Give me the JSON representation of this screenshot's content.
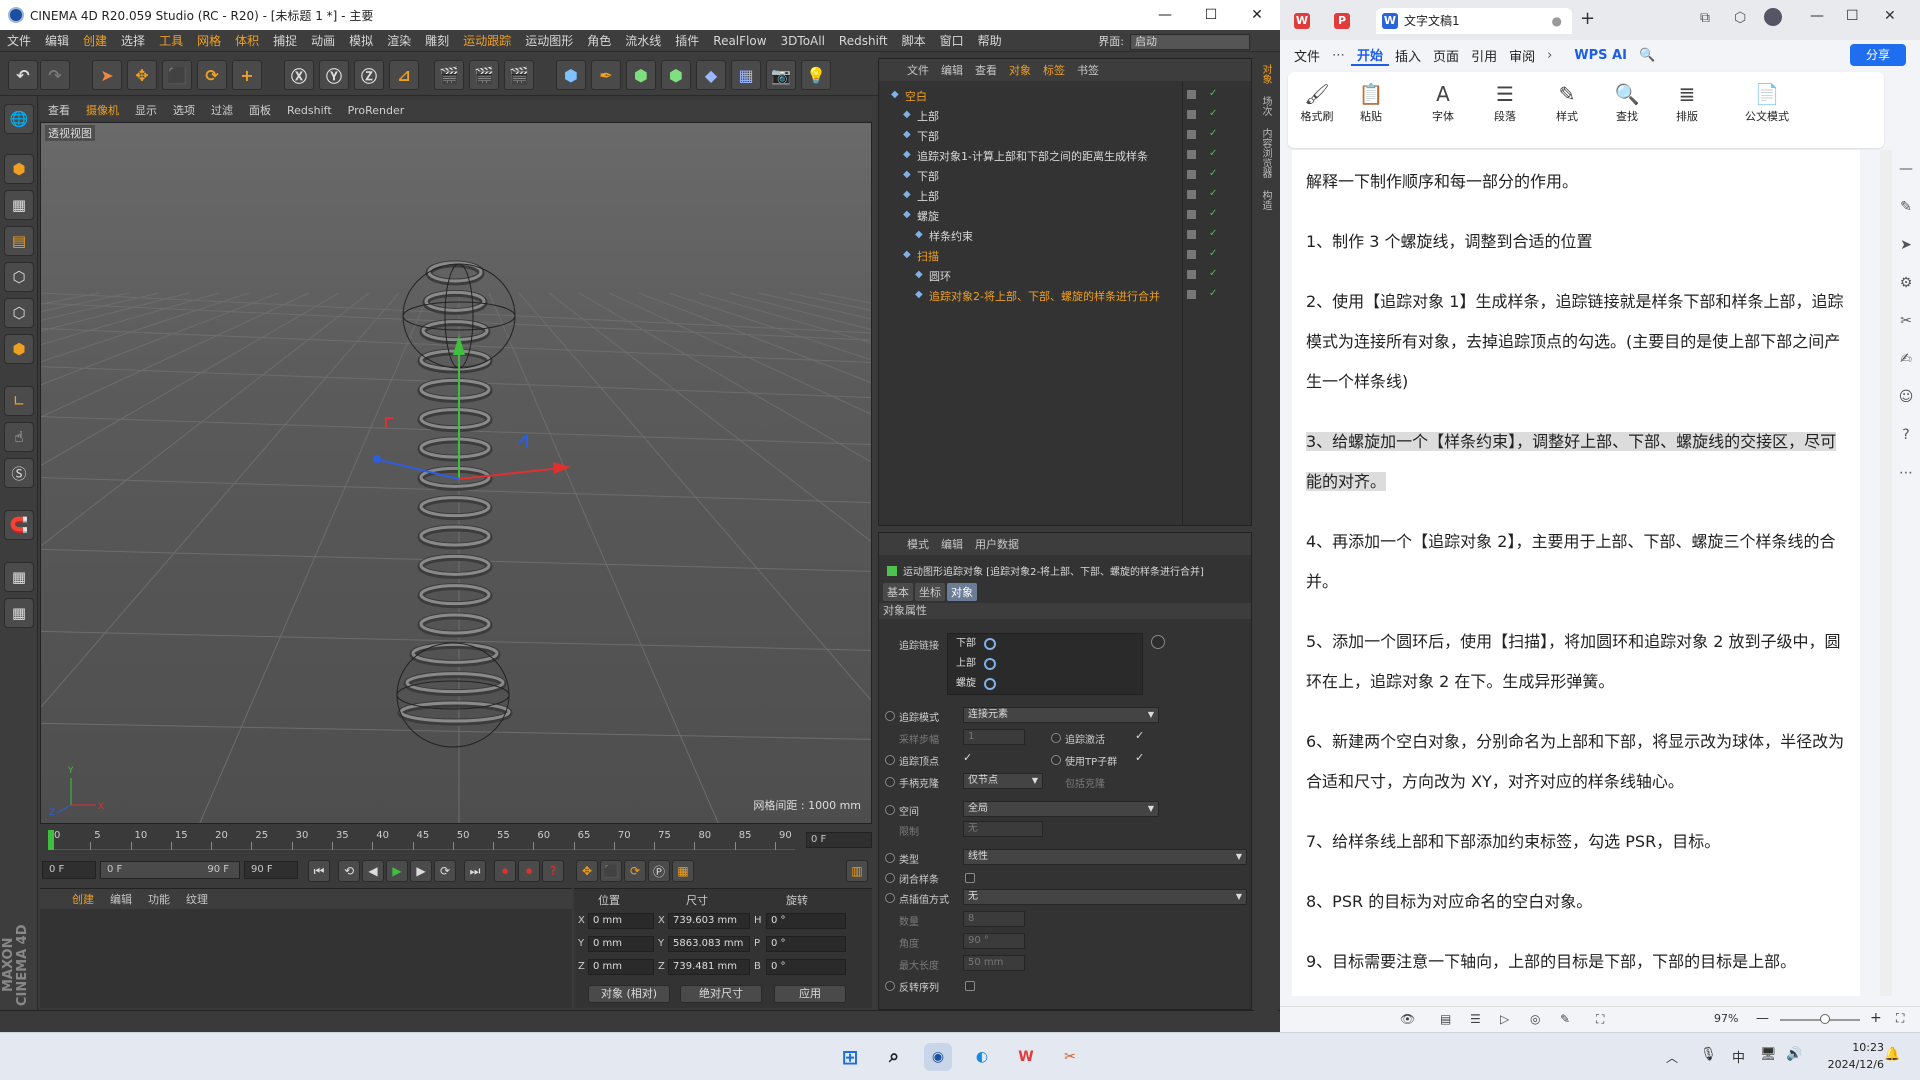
{
  "c4d": {
    "title": "CINEMA 4D R20.059 Studio (RC - R20) - [未标题 1 *] - 主要",
    "menu": [
      "文件",
      "编辑",
      "创建",
      "选择",
      "工具",
      "网格",
      "体积",
      "捕捉",
      "动画",
      "模拟",
      "渲染",
      "雕刻",
      "运动跟踪",
      "运动图形",
      "角色",
      "流水线",
      "插件",
      "RealFlow",
      "3DToAll",
      "Redshift",
      "脚本",
      "窗口",
      "帮助"
    ],
    "interface_label": "界面:",
    "interface_value": "启动",
    "viewport_menu": [
      "查看",
      "摄像机",
      "显示",
      "选项",
      "过滤",
      "面板",
      "Redshift",
      "ProRender"
    ],
    "viewport_label": "透视视图",
    "grid_distance": "网格间距 : 1000 mm",
    "timeline_ticks": [
      "0",
      "5",
      "10",
      "15",
      "20",
      "25",
      "30",
      "35",
      "40",
      "45",
      "50",
      "55",
      "60",
      "65",
      "70",
      "75",
      "80",
      "85",
      "90"
    ],
    "timeline_frame": "0 F",
    "play_start": "0 F",
    "play_range_start": "0 F",
    "play_range_end": "90 F",
    "play_end": "90 F",
    "material_menu": [
      "创建",
      "编辑",
      "功能",
      "纹理"
    ],
    "coords": {
      "headers": [
        "位置",
        "尺寸",
        "旋转"
      ],
      "rows": [
        {
          "axis": "X",
          "pos": "0 mm",
          "size_axis": "X",
          "size": "739.603 mm",
          "rot_axis": "H",
          "rot": "0 °"
        },
        {
          "axis": "Y",
          "pos": "0 mm",
          "size_axis": "Y",
          "size": "5863.083 mm",
          "rot_axis": "P",
          "rot": "0 °"
        },
        {
          "axis": "Z",
          "pos": "0 mm",
          "size_axis": "Z",
          "size": "739.481 mm",
          "rot_axis": "B",
          "rot": "0 °"
        }
      ],
      "mode_select": "对象 (相对)",
      "size_select": "绝对尺寸",
      "apply_label": "应用"
    },
    "maxon_logo": "MAXON CINEMA 4D",
    "object_manager": {
      "menu": [
        "文件",
        "编辑",
        "查看",
        "对象",
        "标签",
        "书签"
      ],
      "items": [
        {
          "name": "空白",
          "indent": 0,
          "selected": true
        },
        {
          "name": "上部",
          "indent": 1,
          "selected": false
        },
        {
          "name": "下部",
          "indent": 1,
          "selected": false
        },
        {
          "name": "追踪对象1-计算上部和下部之间的距离生成样条",
          "indent": 1,
          "selected": false
        },
        {
          "name": "下部",
          "indent": 1,
          "selected": false
        },
        {
          "name": "上部",
          "indent": 1,
          "selected": false
        },
        {
          "name": "螺旋",
          "indent": 1,
          "selected": false
        },
        {
          "name": "样条约束",
          "indent": 2,
          "selected": false
        },
        {
          "name": "扫描",
          "indent": 1,
          "selected": true
        },
        {
          "name": "圆环",
          "indent": 2,
          "selected": false
        },
        {
          "name": "追踪对象2-将上部、下部、螺旋的样条进行合并",
          "indent": 2,
          "selected": true
        }
      ]
    },
    "side_tabs": [
      "对象",
      "场次",
      "内容浏览器",
      "构造"
    ],
    "attribute_manager": {
      "menu": [
        "模式",
        "编辑",
        "用户数据"
      ],
      "title": "运动图形追踪对象 [追踪对象2-将上部、下部、螺旋的样条进行合并]",
      "tabs": [
        "基本",
        "坐标",
        "对象"
      ],
      "section": "对象属性",
      "track_link_label": "追踪链接",
      "track_links": [
        "下部",
        "上部",
        "螺旋"
      ],
      "track_mode_label": "追踪模式",
      "track_mode": "连接元素",
      "sample_step_label": "采样步幅",
      "sample_step": "1",
      "track_active_label": "追踪激活",
      "track_vertex_label": "追踪顶点",
      "use_tp_label": "使用TP子群",
      "handle_clone_label": "手柄克隆",
      "handle_clone": "仅节点",
      "include_clone_label": "包括克隆",
      "space_label": "空间",
      "space": "全局",
      "limit_label": "限制",
      "limit": "无",
      "type_label": "类型",
      "type": "线性",
      "close_spline_label": "闭合样条",
      "interp_label": "点插值方式",
      "interp": "无",
      "count_label": "数量",
      "count": "8",
      "angle_label": "角度",
      "angle": "90 °",
      "max_len_label": "最大长度",
      "max_len": "50 mm",
      "reverse_label": "反转序列"
    }
  },
  "wps": {
    "tabs": [
      {
        "label": "",
        "icon": "W",
        "color": "#e23b3b"
      },
      {
        "label": "",
        "icon": "P",
        "color": "#e23b3b"
      },
      {
        "label": "文字文稿1",
        "icon": "W",
        "color": "#2b63d9"
      }
    ],
    "ribbon_tabs": [
      "文件",
      "开始",
      "插入",
      "页面",
      "引用",
      "审阅"
    ],
    "wps_ai": "WPS AI",
    "share": "分享",
    "ribbon_groups": [
      {
        "icon": "🖌",
        "label": "格式刷"
      },
      {
        "icon": "📋",
        "label": "粘贴"
      },
      {
        "icon": "A",
        "label": "字体"
      },
      {
        "icon": "☰",
        "label": "段落"
      },
      {
        "icon": "✎",
        "label": "样式"
      },
      {
        "icon": "🔍",
        "label": "查找"
      },
      {
        "icon": "≣",
        "label": "排版"
      },
      {
        "icon": "📄",
        "label": "公文模式"
      }
    ],
    "paragraphs": [
      "解释一下制作顺序和每一部分的作用。",
      "1、制作 3 个螺旋线，调整到合适的位置",
      "2、使用【追踪对象 1】生成样条，追踪链接就是样条下部和样条上部，追踪模式为连接所有对象，去掉追踪顶点的勾选。(主要目的是使上部下部之间产生一个样条线)",
      "3、给螺旋加一个【样条约束】，调整好上部、下部、螺旋线的交接区，尽可能的对齐。",
      "4、再添加一个【追踪对象 2】，主要用于上部、下部、螺旋三个样条线的合并。",
      "5、添加一个圆环后，使用【扫描】，将加圆环和追踪对象 2 放到子级中，圆环在上，追踪对象 2 在下。生成异形弹簧。",
      "6、新建两个空白对象，分别命名为上部和下部，将显示改为球体，半径改为合适和尺寸，方向改为 XY，对齐对应的样条线轴心。",
      "7、给样条线上部和下部添加约束标签，勾选 PSR，目标。",
      "8、PSR 的目标为对应命名的空白对象。",
      "9、目标需要注意一下轴向，上部的目标是下部，下部的目标是上部。"
    ],
    "zoom": "97%"
  },
  "taskbar": {
    "time": "10:23",
    "date": "2024/12/6",
    "ime": "中"
  }
}
